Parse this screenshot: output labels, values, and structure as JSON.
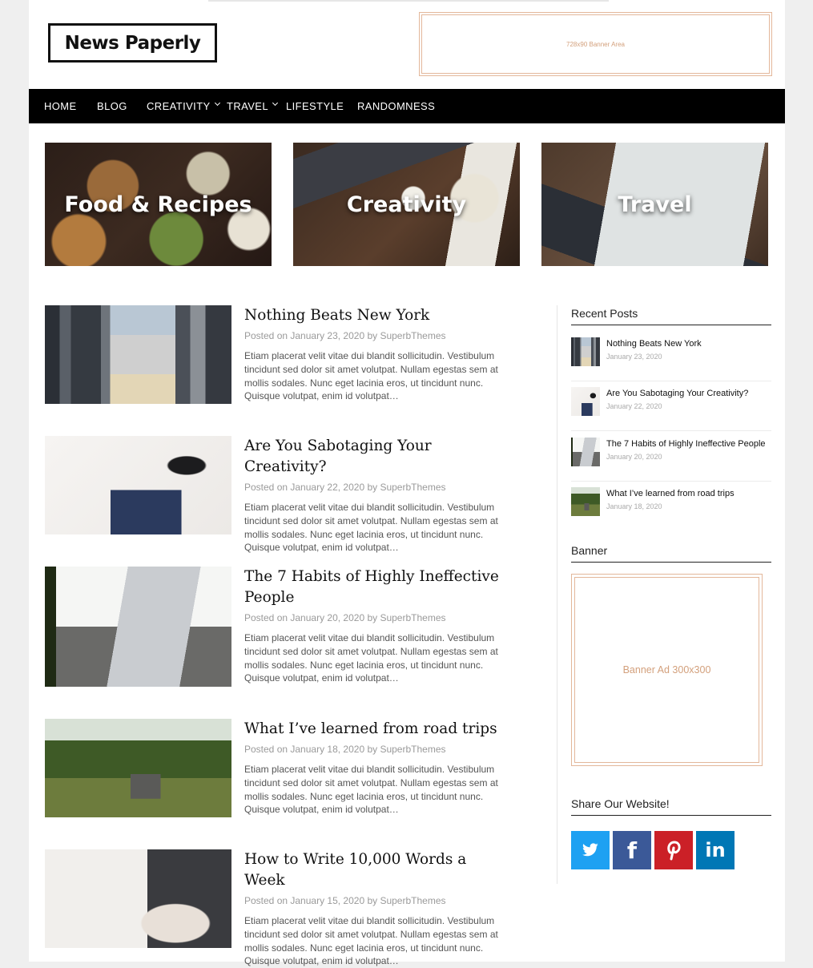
{
  "header": {
    "logo": "News Paperly",
    "top_banner": "728x90 Banner Area"
  },
  "nav": {
    "items": [
      {
        "label": "HOME",
        "dropdown": false
      },
      {
        "label": "BLOG",
        "dropdown": false
      },
      {
        "label": "CREATIVITY",
        "dropdown": true
      },
      {
        "label": "TRAVEL",
        "dropdown": true
      },
      {
        "label": "LIFESTYLE",
        "dropdown": false
      },
      {
        "label": "RANDOMNESS",
        "dropdown": false
      }
    ]
  },
  "features": [
    {
      "label": "Food & Recipes"
    },
    {
      "label": "Creativity"
    },
    {
      "label": "Travel"
    }
  ],
  "posts": [
    {
      "title": "Nothing Beats New York",
      "meta": "Posted on January 23, 2020 by SuperbThemes",
      "excerpt": "Etiam placerat velit vitae dui blandit sollicitudin. Vestibulum tincidunt sed dolor sit amet volutpat. Nullam egestas sem at mollis sodales. Nunc eget lacinia eros, ut tincidunt nunc. Quisque volutpat, enim id volutpat…"
    },
    {
      "title": "Are You Sabotaging Your Creativity?",
      "meta": "Posted on January 22, 2020 by SuperbThemes",
      "excerpt": "Etiam placerat velit vitae dui blandit sollicitudin. Vestibulum tincidunt sed dolor sit amet volutpat. Nullam egestas sem at mollis sodales. Nunc eget lacinia eros, ut tincidunt nunc. Quisque volutpat, enim id volutpat…"
    },
    {
      "title": "The 7 Habits of Highly Ineffective People",
      "meta": "Posted on January 20, 2020 by SuperbThemes",
      "excerpt": "Etiam placerat velit vitae dui blandit sollicitudin. Vestibulum tincidunt sed dolor sit amet volutpat. Nullam egestas sem at mollis sodales. Nunc eget lacinia eros, ut tincidunt nunc. Quisque volutpat, enim id volutpat…"
    },
    {
      "title": "What I’ve learned from road trips",
      "meta": "Posted on January 18, 2020 by SuperbThemes",
      "excerpt": "Etiam placerat velit vitae dui blandit sollicitudin. Vestibulum tincidunt sed dolor sit amet volutpat. Nullam egestas sem at mollis sodales. Nunc eget lacinia eros, ut tincidunt nunc. Quisque volutpat, enim id volutpat…"
    },
    {
      "title": "How to Write 10,000 Words a Week",
      "meta": "Posted on January 15, 2020 by SuperbThemes",
      "excerpt": "Etiam placerat velit vitae dui blandit sollicitudin. Vestibulum tincidunt sed dolor sit amet volutpat. Nullam egestas sem at mollis sodales. Nunc eget lacinia eros, ut tincidunt nunc. Quisque volutpat, enim id volutpat…"
    }
  ],
  "sidebar": {
    "recent_title": "Recent Posts",
    "recent": [
      {
        "title": "Nothing Beats New York",
        "date": "January 23, 2020"
      },
      {
        "title": "Are You Sabotaging Your Creativity?",
        "date": "January 22, 2020"
      },
      {
        "title": "The 7 Habits of Highly Ineffective People",
        "date": "January 20, 2020"
      },
      {
        "title": "What I’ve learned from road trips",
        "date": "January 18, 2020"
      }
    ],
    "banner_title": "Banner",
    "banner_text": "Banner Ad 300x300",
    "share_title": "Share Our Website!",
    "share": [
      {
        "network": "twitter",
        "icon": "twitter-bird-icon",
        "glyph": "",
        "color": "#1ea1f2"
      },
      {
        "network": "facebook",
        "icon": "facebook-icon",
        "glyph": "f",
        "color": "#3b5998"
      },
      {
        "network": "pinterest",
        "icon": "pinterest-icon",
        "glyph": "p",
        "color": "#cb2027"
      },
      {
        "network": "linkedin",
        "icon": "linkedin-icon",
        "glyph": "in",
        "color": "#0077b5"
      }
    ]
  }
}
